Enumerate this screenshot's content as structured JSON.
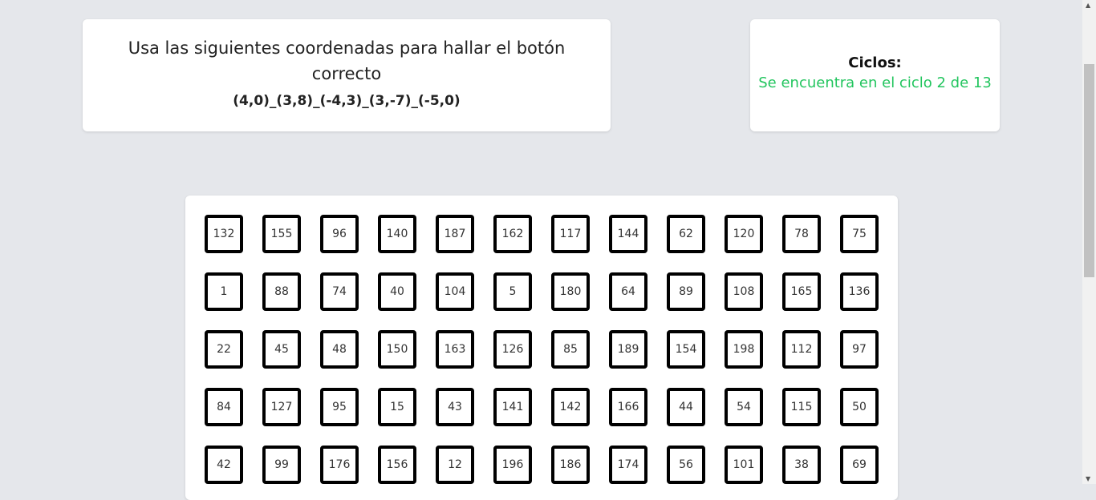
{
  "instructions": {
    "text": "Usa las siguientes coordenadas para hallar el botón correcto",
    "coordinates": "(4,0)_(3,8)_(-4,3)_(3,-7)_(-5,0)"
  },
  "cycles": {
    "title": "Ciclos:",
    "status": "Se encuentra en el ciclo 2 de 13",
    "status_color": "#22c55e"
  },
  "grid": {
    "rows": [
      [
        "132",
        "155",
        "96",
        "140",
        "187",
        "162",
        "117",
        "144",
        "62",
        "120",
        "78",
        "75"
      ],
      [
        "1",
        "88",
        "74",
        "40",
        "104",
        "5",
        "180",
        "64",
        "89",
        "108",
        "165",
        "136"
      ],
      [
        "22",
        "45",
        "48",
        "150",
        "163",
        "126",
        "85",
        "189",
        "154",
        "198",
        "112",
        "97"
      ],
      [
        "84",
        "127",
        "95",
        "15",
        "43",
        "141",
        "142",
        "166",
        "44",
        "54",
        "115",
        "50"
      ],
      [
        "42",
        "99",
        "176",
        "156",
        "12",
        "196",
        "186",
        "174",
        "56",
        "101",
        "38",
        "69"
      ]
    ]
  }
}
